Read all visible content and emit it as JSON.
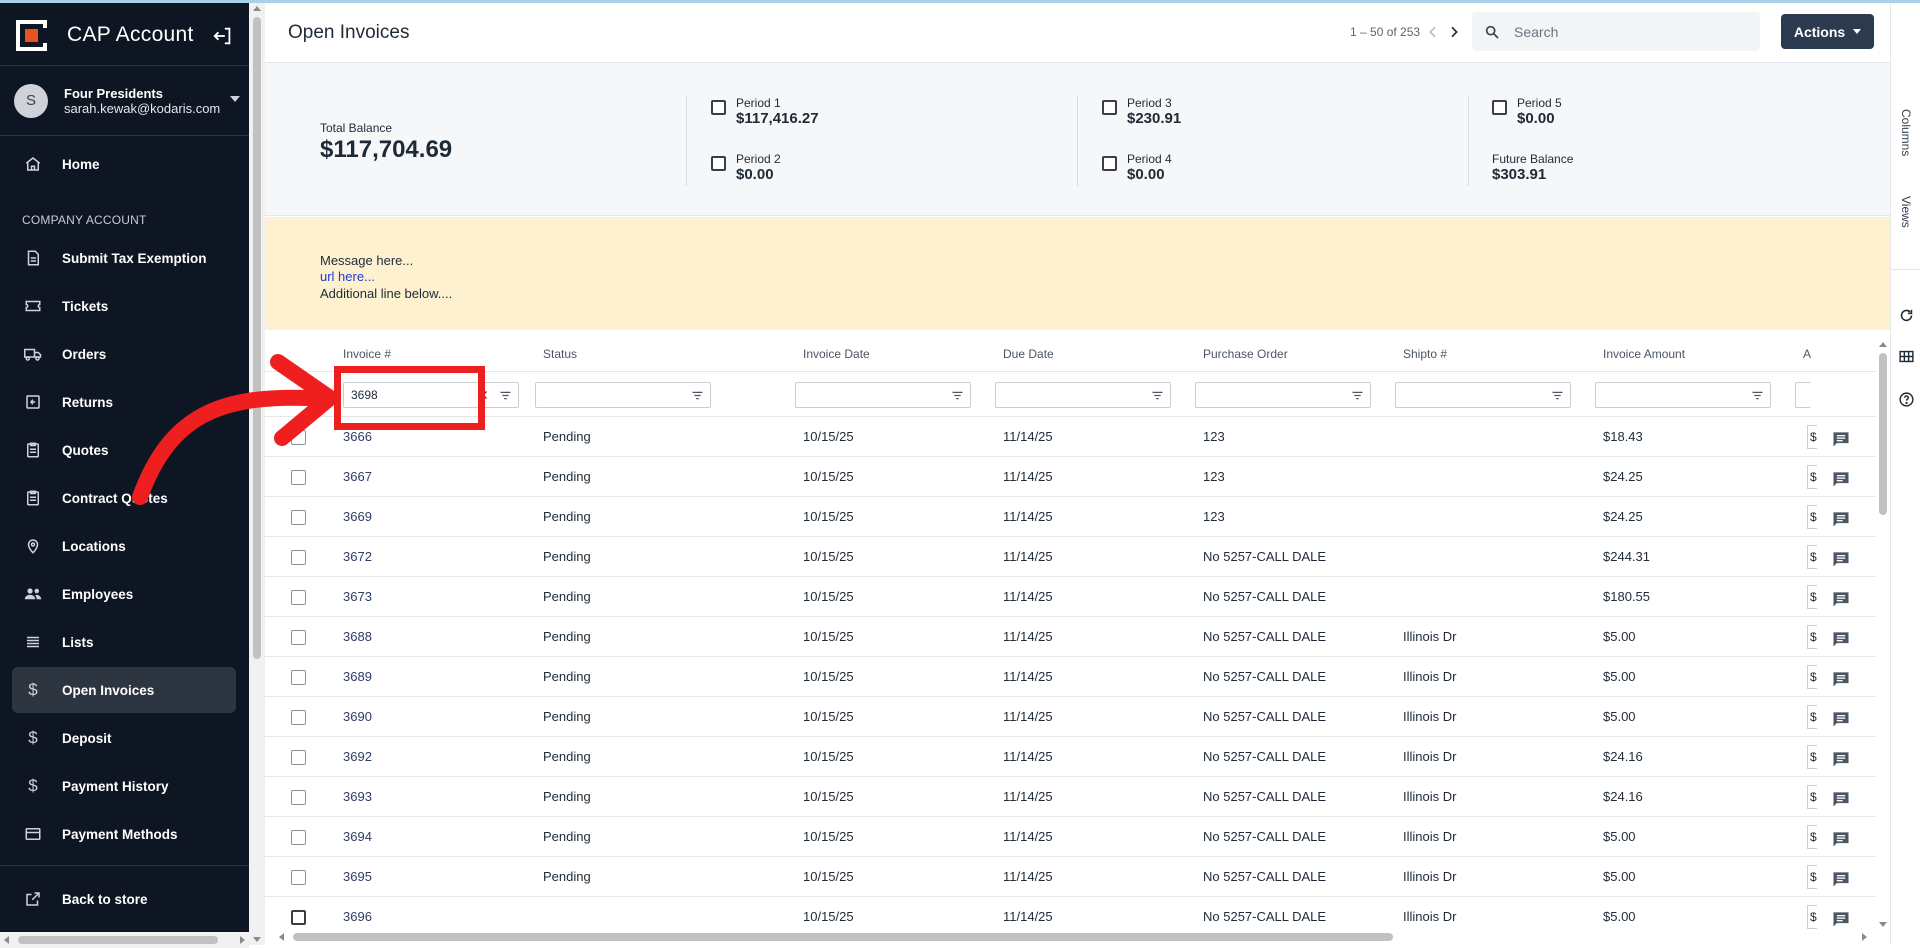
{
  "app": {
    "title": "CAP Account",
    "accent": "#e8521e",
    "sidebar_bg": "#0d1622"
  },
  "user": {
    "initial": "S",
    "company": "Four Presidents",
    "email": "sarah.kewak@kodaris.com"
  },
  "sidebar": {
    "home": {
      "label": "Home",
      "icon": "home-icon"
    },
    "section_label": "COMPANY ACCOUNT",
    "items": [
      {
        "label": "Submit Tax Exemption",
        "icon": "document-icon"
      },
      {
        "label": "Tickets",
        "icon": "ticket-icon"
      },
      {
        "label": "Orders",
        "icon": "truck-icon"
      },
      {
        "label": "Returns",
        "icon": "return-icon"
      },
      {
        "label": "Quotes",
        "icon": "clipboard-icon"
      },
      {
        "label": "Contract Quotes",
        "icon": "clipboard-icon"
      },
      {
        "label": "Locations",
        "icon": "pin-icon"
      },
      {
        "label": "Employees",
        "icon": "people-icon"
      },
      {
        "label": "Lists",
        "icon": "list-icon"
      },
      {
        "label": "Open Invoices",
        "icon": "dollar-icon",
        "active": true
      },
      {
        "label": "Deposit",
        "icon": "dollar-icon"
      },
      {
        "label": "Payment History",
        "icon": "dollar-icon"
      },
      {
        "label": "Payment Methods",
        "icon": "card-icon"
      }
    ],
    "back": {
      "label": "Back to store",
      "icon": "external-link-icon"
    }
  },
  "header": {
    "title": "Open Invoices",
    "pager": "1 – 50 of 253",
    "search_placeholder": "Search",
    "actions_label": "Actions"
  },
  "summary": {
    "total_label": "Total Balance",
    "total_value": "$117,704.69",
    "periods": [
      {
        "label": "Period 1",
        "value": "$117,416.27"
      },
      {
        "label": "Period 2",
        "value": "$0.00"
      },
      {
        "label": "Period 3",
        "value": "$230.91"
      },
      {
        "label": "Period 4",
        "value": "$0.00"
      },
      {
        "label": "Period 5",
        "value": "$0.00"
      }
    ],
    "future_label": "Future Balance",
    "future_value": "$303.91"
  },
  "banner": {
    "line1": "Message here...",
    "link": "url here...",
    "line3": "Additional line below...."
  },
  "right_rail": {
    "columns": "Columns",
    "views": "Views"
  },
  "table": {
    "columns": [
      "Invoice #",
      "Status",
      "Invoice Date",
      "Due Date",
      "Purchase Order",
      "Shipto #",
      "Invoice Amount",
      "A"
    ],
    "invoice_filter_value": "3698",
    "amount_stub": "$",
    "rows": [
      {
        "invoice": "3666",
        "status": "Pending",
        "invoice_date": "10/15/25",
        "due_date": "11/14/25",
        "po": "123",
        "shipto": "",
        "amount": "$18.43"
      },
      {
        "invoice": "3667",
        "status": "Pending",
        "invoice_date": "10/15/25",
        "due_date": "11/14/25",
        "po": "123",
        "shipto": "",
        "amount": "$24.25"
      },
      {
        "invoice": "3669",
        "status": "Pending",
        "invoice_date": "10/15/25",
        "due_date": "11/14/25",
        "po": "123",
        "shipto": "",
        "amount": "$24.25"
      },
      {
        "invoice": "3672",
        "status": "Pending",
        "invoice_date": "10/15/25",
        "due_date": "11/14/25",
        "po": "No 5257-CALL DALE",
        "shipto": "",
        "amount": "$244.31"
      },
      {
        "invoice": "3673",
        "status": "Pending",
        "invoice_date": "10/15/25",
        "due_date": "11/14/25",
        "po": "No 5257-CALL DALE",
        "shipto": "",
        "amount": "$180.55"
      },
      {
        "invoice": "3688",
        "status": "Pending",
        "invoice_date": "10/15/25",
        "due_date": "11/14/25",
        "po": "No 5257-CALL DALE",
        "shipto": "Illinois Dr",
        "amount": "$5.00"
      },
      {
        "invoice": "3689",
        "status": "Pending",
        "invoice_date": "10/15/25",
        "due_date": "11/14/25",
        "po": "No 5257-CALL DALE",
        "shipto": "Illinois Dr",
        "amount": "$5.00"
      },
      {
        "invoice": "3690",
        "status": "Pending",
        "invoice_date": "10/15/25",
        "due_date": "11/14/25",
        "po": "No 5257-CALL DALE",
        "shipto": "Illinois Dr",
        "amount": "$5.00"
      },
      {
        "invoice": "3692",
        "status": "Pending",
        "invoice_date": "10/15/25",
        "due_date": "11/14/25",
        "po": "No 5257-CALL DALE",
        "shipto": "Illinois Dr",
        "amount": "$24.16"
      },
      {
        "invoice": "3693",
        "status": "Pending",
        "invoice_date": "10/15/25",
        "due_date": "11/14/25",
        "po": "No 5257-CALL DALE",
        "shipto": "Illinois Dr",
        "amount": "$24.16"
      },
      {
        "invoice": "3694",
        "status": "Pending",
        "invoice_date": "10/15/25",
        "due_date": "11/14/25",
        "po": "No 5257-CALL DALE",
        "shipto": "Illinois Dr",
        "amount": "$5.00"
      },
      {
        "invoice": "3695",
        "status": "Pending",
        "invoice_date": "10/15/25",
        "due_date": "11/14/25",
        "po": "No 5257-CALL DALE",
        "shipto": "Illinois Dr",
        "amount": "$5.00"
      },
      {
        "invoice": "3696",
        "status": "",
        "invoice_date": "10/15/25",
        "due_date": "11/14/25",
        "po": "No 5257-CALL DALE",
        "shipto": "Illinois Dr",
        "amount": "$5.00"
      }
    ]
  },
  "annotation": {
    "highlight_color": "#ef1f1f"
  }
}
